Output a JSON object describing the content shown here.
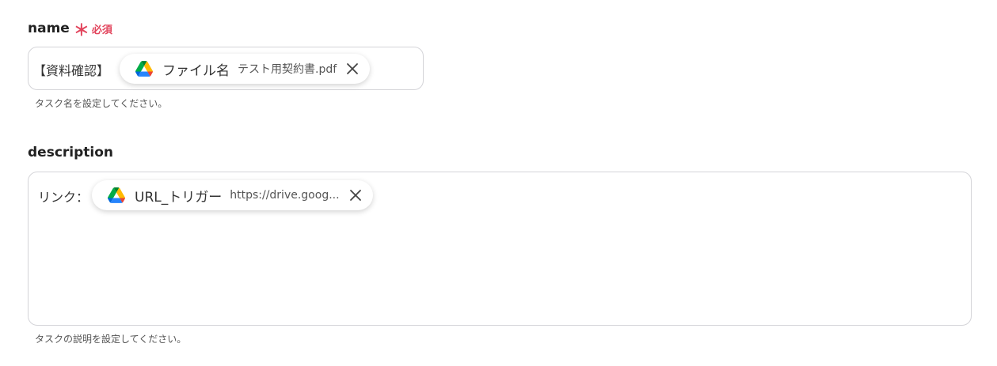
{
  "name_field": {
    "label": "name",
    "required_mark": "＊",
    "required_text": "必須",
    "prefix_text": "【資料確認】",
    "chip": {
      "icon": "google-drive-icon",
      "label": "ファイル名",
      "value": "テスト用契約書.pdf"
    },
    "help_text": "タスク名を設定してください。"
  },
  "description_field": {
    "label": "description",
    "prefix_text": "リンク：",
    "chip": {
      "icon": "google-drive-icon",
      "label": "URL_トリガー",
      "value": "https://drive.goog..."
    },
    "help_text": "タスクの説明を設定してください。"
  },
  "colors": {
    "required": "#e2445c",
    "border": "#d4d4d8",
    "text": "#222222"
  }
}
